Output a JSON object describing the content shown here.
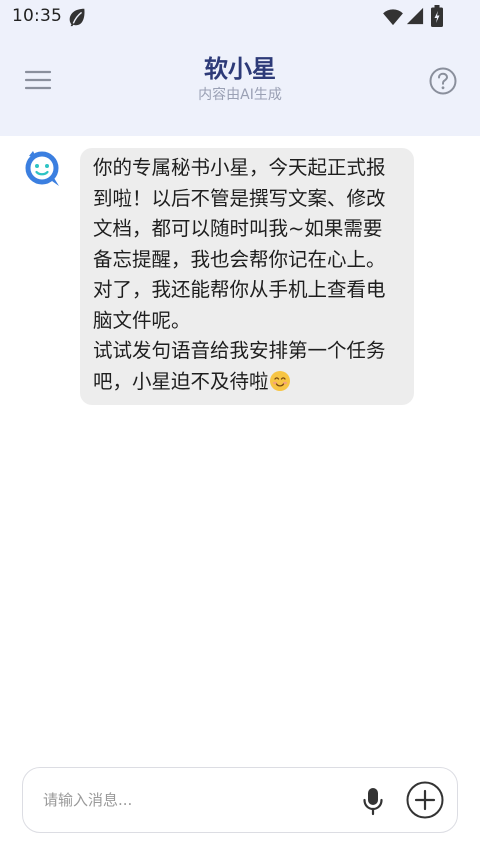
{
  "status_bar": {
    "time": "10:35",
    "icons": [
      "leaf-icon",
      "wifi-icon",
      "signal-icon",
      "battery-icon"
    ]
  },
  "header": {
    "title": "软小星",
    "subtitle": "内容由AI生成",
    "left_icon": "menu-icon",
    "right_icon": "help-icon"
  },
  "chat": {
    "messages": [
      {
        "sender": "bot",
        "avatar_icon": "bot-avatar-icon",
        "text": "你的专属秘书小星，今天起正式报到啦！以后不管是撰写文案、修改文档，都可以随时叫我~如果需要备忘提醒，我也会帮你记在心上。对了，我还能帮你从手机上查看电脑文件呢。\n试试发句语音给我安排第一个任务吧，小星迫不及待啦",
        "trailing_emoji": "smiling-face-emoji"
      }
    ]
  },
  "input_bar": {
    "placeholder": "请输入消息...",
    "value": "",
    "mic_icon": "microphone-icon",
    "add_icon": "plus-circle-icon"
  },
  "colors": {
    "header_bg": "#eef1fb",
    "title": "#2d3a78",
    "subtitle": "#9aa0b4",
    "bubble_bg": "#ededed",
    "avatar_accent": "#3b7fe0"
  }
}
